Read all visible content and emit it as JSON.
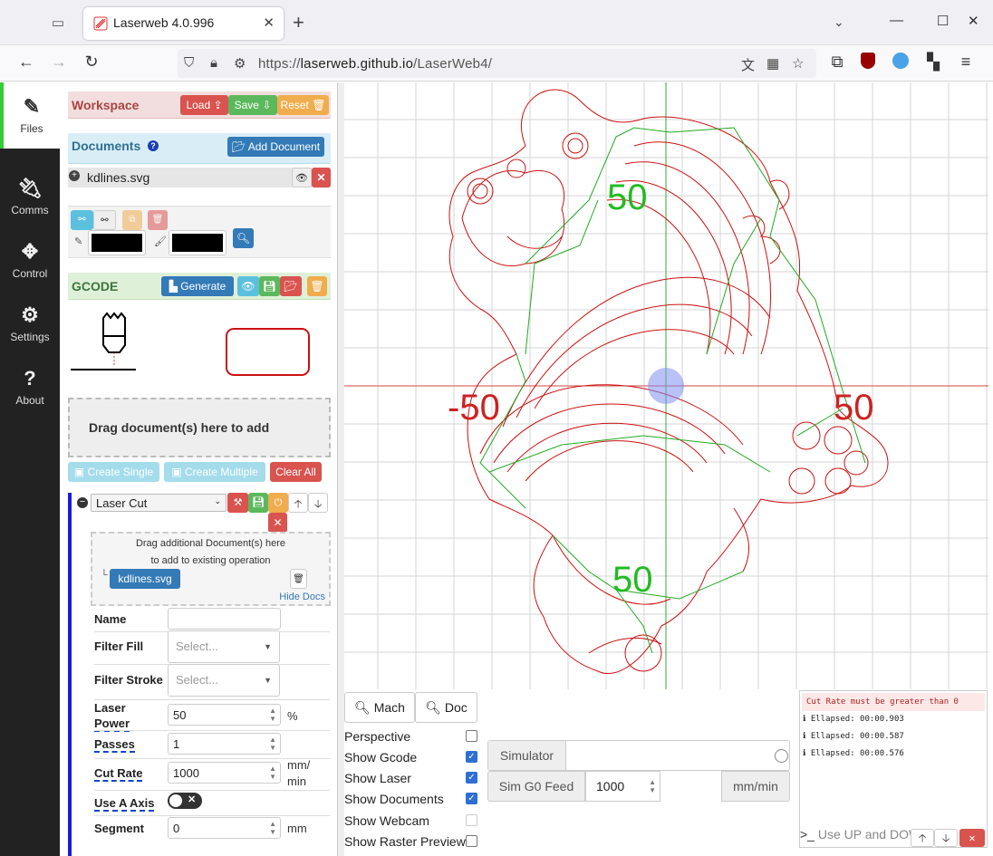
{
  "browser": {
    "tab_title": "Laserweb 4.0.996",
    "url_scheme": "https://",
    "url_host": "laserweb.github.io",
    "url_path": "/LaserWeb4/"
  },
  "leftnav": {
    "items": [
      {
        "label": "Files",
        "icon": "file-edit-icon"
      },
      {
        "label": "Comms",
        "icon": "plug-icon"
      },
      {
        "label": "Control",
        "icon": "arrows-icon"
      },
      {
        "label": "Settings",
        "icon": "gears-icon"
      },
      {
        "label": "About",
        "icon": "question-icon"
      }
    ]
  },
  "workspace": {
    "title": "Workspace",
    "load": "Load",
    "save": "Save",
    "reset": "Reset"
  },
  "documents": {
    "title": "Documents",
    "add": "Add Document",
    "file": "kdlines.svg"
  },
  "gcode": {
    "title": "GCODE",
    "generate": "Generate"
  },
  "dropzone": "Drag document(s) here to add",
  "op_buttons": {
    "create_single": "Create Single",
    "create_multiple": "Create Multiple",
    "clear_all": "Clear All"
  },
  "operation": {
    "type": "Laser Cut",
    "drag_line1": "Drag additional Document(s) here",
    "drag_line2": "to add to existing operation",
    "doc": "kdlines.svg",
    "hide_docs": "Hide Docs",
    "fields": {
      "name_label": "Name",
      "filter_fill_label": "Filter Fill",
      "filter_fill_placeholder": "Select...",
      "filter_stroke_label": "Filter Stroke",
      "filter_stroke_placeholder": "Select...",
      "laser_power_label_1": "Laser",
      "laser_power_label_2": "Power",
      "laser_power": "50",
      "laser_power_unit": "%",
      "passes_label": "Passes",
      "passes": "1",
      "cut_rate_label": "Cut Rate",
      "cut_rate": "1000",
      "cut_rate_unit_1": "mm/",
      "cut_rate_unit_2": "min",
      "use_a_axis_label": "Use A Axis",
      "segment_label": "Segment",
      "segment": "0",
      "segment_unit": "mm"
    }
  },
  "viewport": {
    "axis_labels": {
      "top": "50",
      "left": "-50",
      "right": "50",
      "bottom": "50"
    },
    "colors": {
      "grid": "#cccccc",
      "axis_x": "#d44444",
      "axis_y": "#33aa33",
      "design": "#cc1111",
      "path": "#22aa22"
    }
  },
  "bottom": {
    "mach": "Mach",
    "doc": "Doc",
    "options": [
      {
        "label": "Perspective",
        "checked": false
      },
      {
        "label": "Show Gcode",
        "checked": true
      },
      {
        "label": "Show Laser",
        "checked": true
      },
      {
        "label": "Show Documents",
        "checked": true
      },
      {
        "label": "Show Webcam",
        "checked": false
      },
      {
        "label": "Show Raster Preview",
        "checked": false
      }
    ],
    "simulator": "Simulator",
    "sim_feed_label": "Sim G0 Feed",
    "sim_feed": "1000",
    "sim_feed_unit": "mm/min"
  },
  "console": {
    "error": "Cut Rate must be greater than 0",
    "lines": [
      "Ellapsed: 00:00.903",
      "Ellapsed: 00:00.587",
      "Ellapsed: 00:00.576"
    ],
    "input_placeholder": "Use UP and DOWN"
  }
}
